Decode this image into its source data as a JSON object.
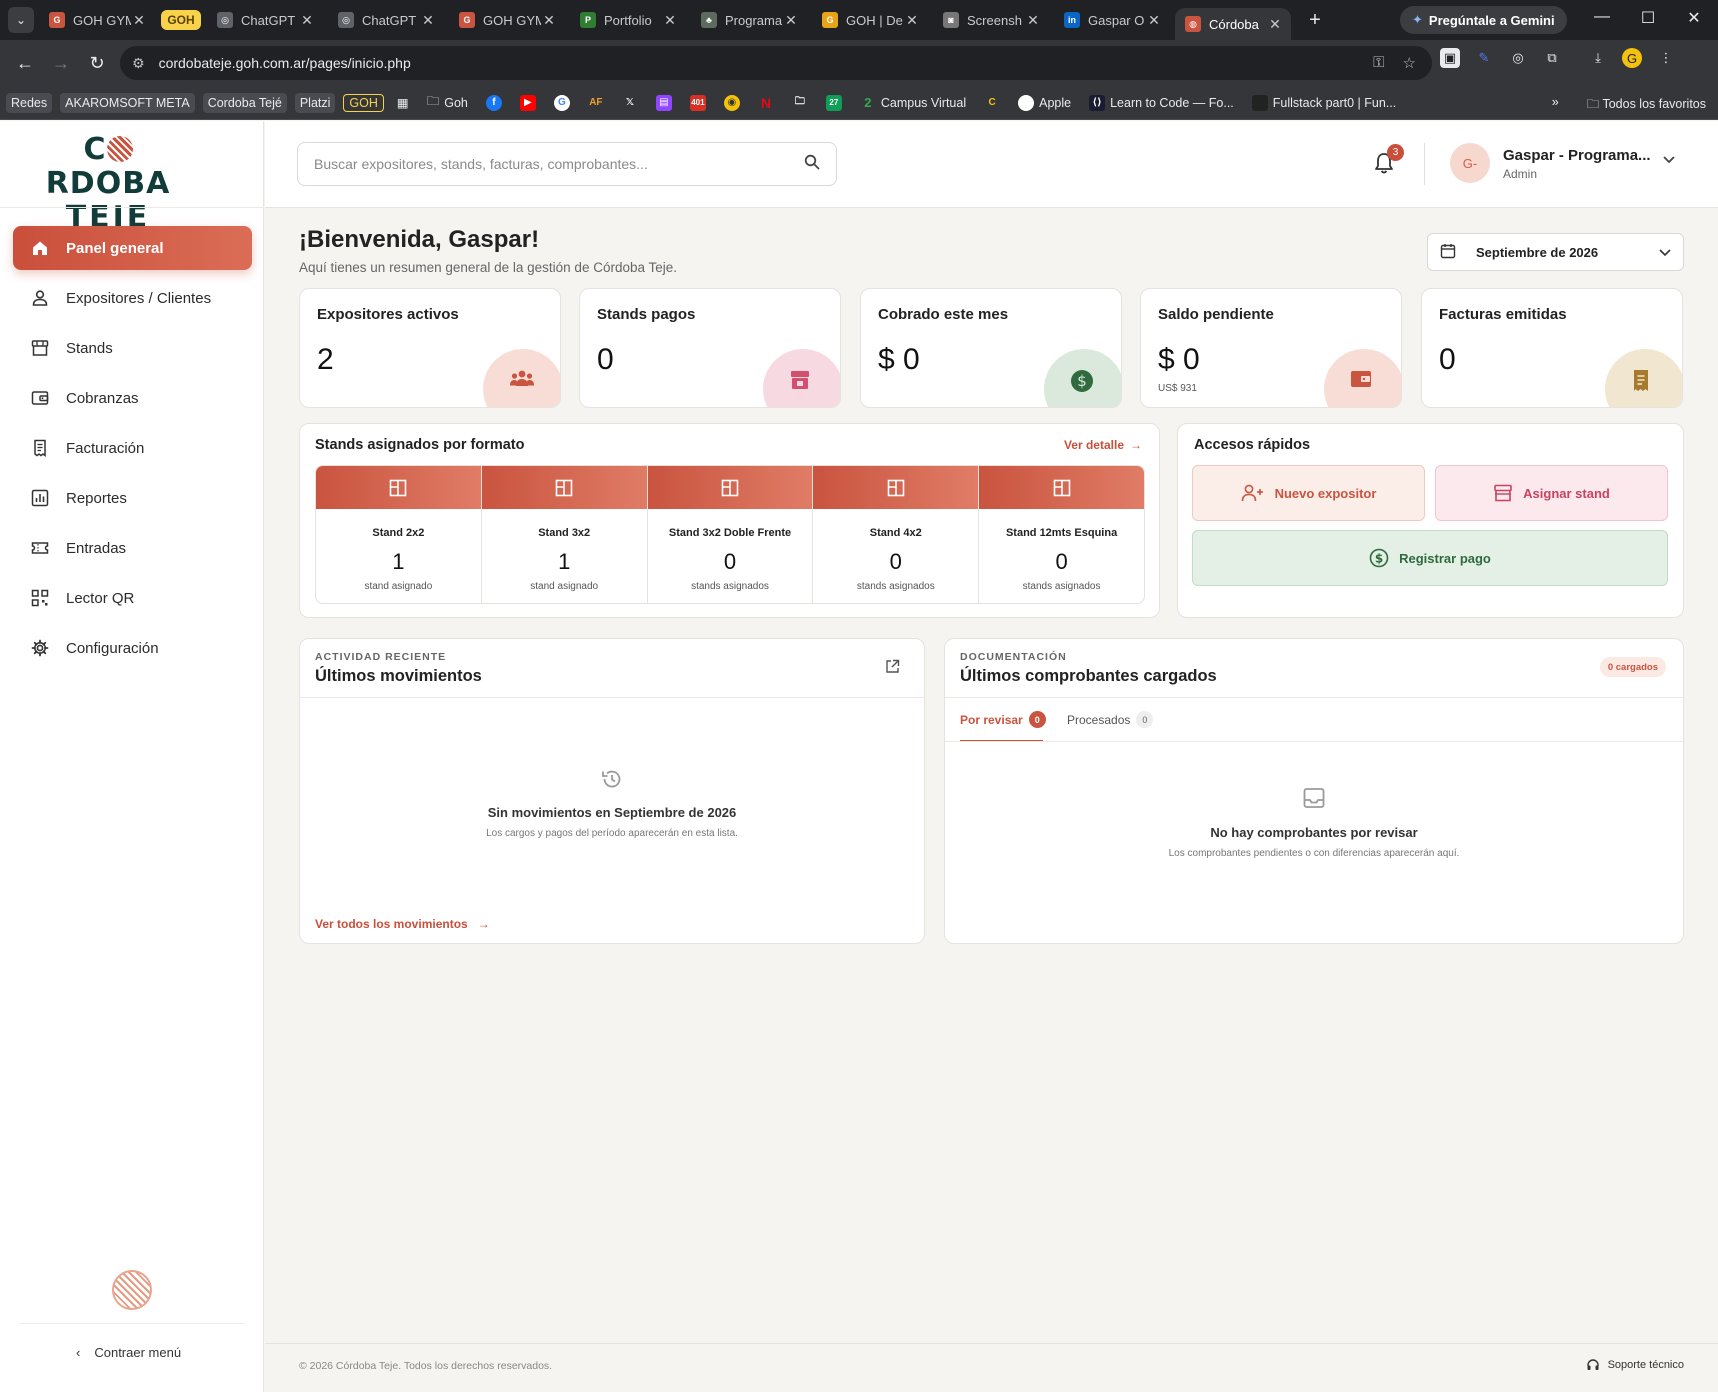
{
  "browser": {
    "tabs": [
      {
        "title": "GOH GYM",
        "color": "#c9543f",
        "glyph": "G"
      },
      {
        "title": "GOH",
        "pill": true
      },
      {
        "title": "ChatGPT",
        "color": "#5f6368",
        "glyph": "◎"
      },
      {
        "title": "ChatGPT",
        "color": "#5f6368",
        "glyph": "◎"
      },
      {
        "title": "GOH GYM",
        "color": "#c9543f",
        "glyph": "G"
      },
      {
        "title": "Portfolio",
        "color": "#2e7d32",
        "glyph": "P"
      },
      {
        "title": "Programa",
        "color": "#5c6b5d",
        "glyph": "♣"
      },
      {
        "title": "GOH | De",
        "color": "#e8a317",
        "glyph": "G"
      },
      {
        "title": "Screensh",
        "color": "#777",
        "glyph": "◙"
      },
      {
        "title": "Gaspar O",
        "color": "#0a66c2",
        "glyph": "in"
      },
      {
        "title": "Córdoba",
        "color": "#c9543f",
        "glyph": "◍",
        "active": true
      }
    ],
    "gemini_label": "Pregúntale a Gemini",
    "url": "cordobateje.goh.com.ar/pages/inicio.php",
    "bookmarks": [
      {
        "label": "Redes",
        "style": "chip"
      },
      {
        "label": "AKAROMSOFT META",
        "style": "chip"
      },
      {
        "label": "Cordoba Tejé",
        "style": "chip"
      },
      {
        "label": "Platzi",
        "style": "chip"
      },
      {
        "label": "GOH",
        "style": "chip-yellow"
      }
    ],
    "bookmarks_tail": [
      {
        "label": "Goh",
        "icon": "folder"
      },
      {
        "label": "Campus Virtual",
        "icon": "2"
      },
      {
        "label": "Apple",
        "icon": "apple"
      },
      {
        "label": "Learn to Code — Fo...",
        "icon": "code"
      },
      {
        "label": "Fullstack part0 | Fun...",
        "icon": "page"
      }
    ],
    "all_bookmarks_label": "Todos los favoritos"
  },
  "sidebar": {
    "logo_line1_a": "C",
    "logo_line1_b": "RDOBA",
    "logo_line2": "TEJE",
    "items": [
      {
        "label": "Panel general",
        "icon": "home-icon",
        "active": true
      },
      {
        "label": "Expositores / Clientes",
        "icon": "user-icon"
      },
      {
        "label": "Stands",
        "icon": "store-icon"
      },
      {
        "label": "Cobranzas",
        "icon": "wallet-icon"
      },
      {
        "label": "Facturación",
        "icon": "receipt-icon"
      },
      {
        "label": "Reportes",
        "icon": "chart-icon"
      },
      {
        "label": "Entradas",
        "icon": "ticket-icon"
      },
      {
        "label": "Lector QR",
        "icon": "qr-icon"
      },
      {
        "label": "Configuración",
        "icon": "gear-icon"
      }
    ],
    "collapse_label": "Contraer menú"
  },
  "topbar": {
    "search_placeholder": "Buscar expositores, stands, facturas, comprobantes...",
    "notifications_count": "3",
    "user_initials": "G-",
    "user_name": "Gaspar - Programa...",
    "user_role": "Admin"
  },
  "main": {
    "greeting": "¡Bienvenida, Gaspar!",
    "subtitle": "Aquí tienes un resumen general de la gestión de Córdoba Teje.",
    "month": "Septiembre de 2026",
    "kpis": [
      {
        "title": "Expositores activos",
        "value": "2",
        "sub": "",
        "icon": "people-icon",
        "circle": "#f7ddd5",
        "icon_color": "#c9543f"
      },
      {
        "title": "Stands pagos",
        "value": "0",
        "sub": "",
        "icon": "store-icon",
        "circle": "#f7d9e1",
        "icon_color": "#d44f6e"
      },
      {
        "title": "Cobrado este mes",
        "value": "$ 0",
        "sub": "",
        "icon": "dollar-icon",
        "circle": "#dbe9dc",
        "icon_color": "#2f6b3f"
      },
      {
        "title": "Saldo pendiente",
        "value": "$ 0",
        "sub": "US$ 931",
        "icon": "wallet-icon",
        "circle": "#f7ddd5",
        "icon_color": "#c9543f"
      },
      {
        "title": "Facturas emitidas",
        "value": "0",
        "sub": "",
        "icon": "receipt-icon",
        "circle": "#f1e6cf",
        "icon_color": "#a77b2e"
      }
    ],
    "stands": {
      "title": "Stands asignados por formato",
      "detail_link": "Ver detalle",
      "items": [
        {
          "name": "Stand 2x2",
          "count": "1",
          "unit": "stand asignado"
        },
        {
          "name": "Stand 3x2",
          "count": "1",
          "unit": "stand asignado"
        },
        {
          "name": "Stand 3x2 Doble Frente",
          "count": "0",
          "unit": "stands asignados"
        },
        {
          "name": "Stand 4x2",
          "count": "0",
          "unit": "stands asignados"
        },
        {
          "name": "Stand 12mts Esquina",
          "count": "0",
          "unit": "stands asignados"
        }
      ]
    },
    "quick": {
      "title": "Accesos rápidos",
      "new_exhibitor": "Nuevo expositor",
      "assign_stand": "Asignar stand",
      "register_payment": "Registrar pago"
    },
    "activity": {
      "kicker": "ACTIVIDAD RECIENTE",
      "title": "Últimos movimientos",
      "empty_title": "Sin movimientos en Septiembre de 2026",
      "empty_sub": "Los cargos y pagos del período aparecerán en esta lista.",
      "all_link": "Ver todos los movimientos"
    },
    "docs": {
      "kicker": "DOCUMENTACIÓN",
      "title": "Últimos comprobantes cargados",
      "loaded_badge": "0 cargados",
      "tab_review": "Por revisar",
      "tab_review_count": "0",
      "tab_processed": "Procesados",
      "tab_processed_count": "0",
      "empty_title": "No hay comprobantes por revisar",
      "empty_sub": "Los comprobantes pendientes o con diferencias aparecerán aquí."
    },
    "footer": {
      "copyright": "© 2026 Córdoba Teje. Todos los derechos reservados.",
      "support": "Soporte técnico"
    }
  }
}
